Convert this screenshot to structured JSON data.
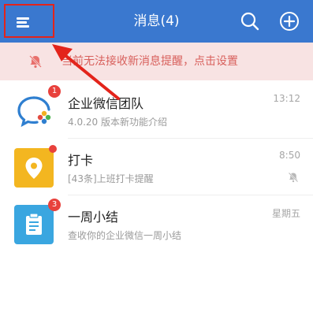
{
  "header": {
    "title": "消息(4)",
    "menu_icon": "hamburger-menu-icon",
    "search_icon": "search-icon",
    "add_icon": "plus-circle-icon",
    "bg_color": "#3a78cf"
  },
  "notice": {
    "text": "当前无法接收新消息提醒，点击设置",
    "icon": "bell-muted-icon",
    "bg_color": "#f8e3e3",
    "text_color": "#d8605c"
  },
  "conversations": [
    {
      "name": "企业微信团队",
      "preview": "4.0.20 版本新功能介绍",
      "time": "13:12",
      "badge": "1",
      "avatar_icon": "wecom-logo-icon"
    },
    {
      "name": "打卡",
      "preview": "[43条]上班打卡提醒",
      "time": "8:50",
      "badge": "",
      "muted": true,
      "avatar_icon": "location-pin-icon",
      "avatar_color": "#f3b620"
    },
    {
      "name": "一周小结",
      "preview": "查收你的企业微信一周小结",
      "time": "星期五",
      "badge": "3",
      "avatar_icon": "clipboard-icon",
      "avatar_color": "#3aa6e0"
    }
  ],
  "annotation": {
    "highlight_color": "#e3241b"
  }
}
